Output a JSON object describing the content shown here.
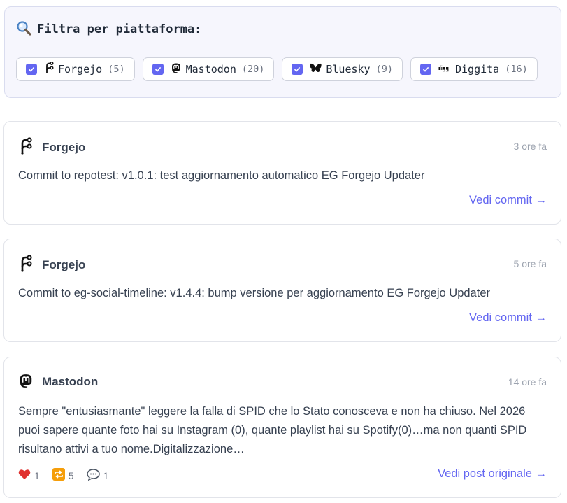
{
  "filter": {
    "title": "Filtra per piattaforma:",
    "icon": "magnifier-icon",
    "chips": [
      {
        "label": "Forgejo",
        "count": "(5)",
        "checked": true
      },
      {
        "label": "Mastodon",
        "count": "(20)",
        "checked": true
      },
      {
        "label": "Bluesky",
        "count": "(9)",
        "checked": true
      },
      {
        "label": "Diggita",
        "count": "(16)",
        "checked": true
      }
    ]
  },
  "colors": {
    "accent": "#6366f1",
    "muted": "#9ca3af",
    "text": "#374151"
  },
  "posts": [
    {
      "platform": "Forgejo",
      "time": "3 ore fa",
      "content": "Commit to repotest: v1.0.1: test aggiornamento automatico EG Forgejo Updater",
      "link": "Vedi commit →"
    },
    {
      "platform": "Forgejo",
      "time": "5 ore fa",
      "content": "Commit to eg-social-timeline: v1.4.4: bump versione per aggiornamento EG Forgejo Updater",
      "link": "Vedi commit →"
    },
    {
      "platform": "Mastodon",
      "time": "14 ore fa",
      "content": "Sempre \"entusiasmante\" leggere la falla di SPID che lo Stato conosceva e non ha chiuso. Nel 2026 puoi sapere quante foto hai su Instagram (0), quante playlist hai su Spotify(0)…ma non quanti SPID risultano attivi a tuo nome.Digitalizzazione…",
      "likes": "1",
      "boosts": "5",
      "replies": "1",
      "link": "Vedi post originale →"
    }
  ]
}
